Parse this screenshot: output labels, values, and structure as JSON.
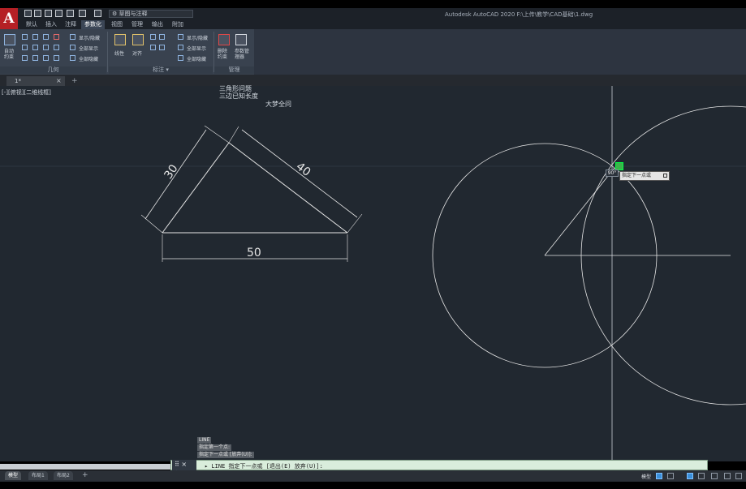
{
  "app": {
    "logo_letter": "A",
    "title": "Autodesk AutoCAD 2020    F:\\上传\\教学\\CAD基础\\1.dwg",
    "workspace": "⚙ 草图与注释",
    "brand_color": "#b52025"
  },
  "ribbon": {
    "tabs": [
      "默认",
      "插入",
      "注释",
      "参数化",
      "视图",
      "管理",
      "输出",
      "附加"
    ],
    "active_tab": "参数化",
    "panels": {
      "geometry": {
        "title": "几何",
        "auto_constrain": "自动约束",
        "show_hide": "显示/隐藏",
        "show_all": "全部显示",
        "hide_all": "全部隐藏"
      },
      "dimensional": {
        "title": "标注 ▾",
        "linear": "线性",
        "aligned": "对齐",
        "show_hide": "显示/隐藏",
        "show_all": "全部显示",
        "hide_all": "全部隐藏"
      },
      "manage": {
        "title": "管理",
        "delete_constraints": "删除约束",
        "parameters_manager": "参数管理器"
      }
    }
  },
  "document": {
    "tab_label": "1*",
    "close": "×",
    "add": "+"
  },
  "canvas": {
    "viewport_label": "[-][俯视][二维线框]",
    "caption_1": "三角形问题",
    "caption_2": "三边已知长度",
    "caption_3": "大梦全问",
    "dimensions": {
      "left": "30",
      "right": "40",
      "bottom": "50"
    },
    "angle_input": "90°",
    "tooltip": "指定下一点或"
  },
  "command": {
    "history": [
      "LINE",
      "指定第一个点:",
      "指定下一点或 [放弃(U)]:"
    ],
    "prefix": "⠿ × 🔧",
    "current": "▸ LINE 指定下一点或 [退出(E) 放弃(U)]:"
  },
  "layouts": {
    "tabs": [
      "模型",
      "布局1",
      "布局2"
    ],
    "add": "+"
  },
  "status": {
    "model": "模型"
  }
}
